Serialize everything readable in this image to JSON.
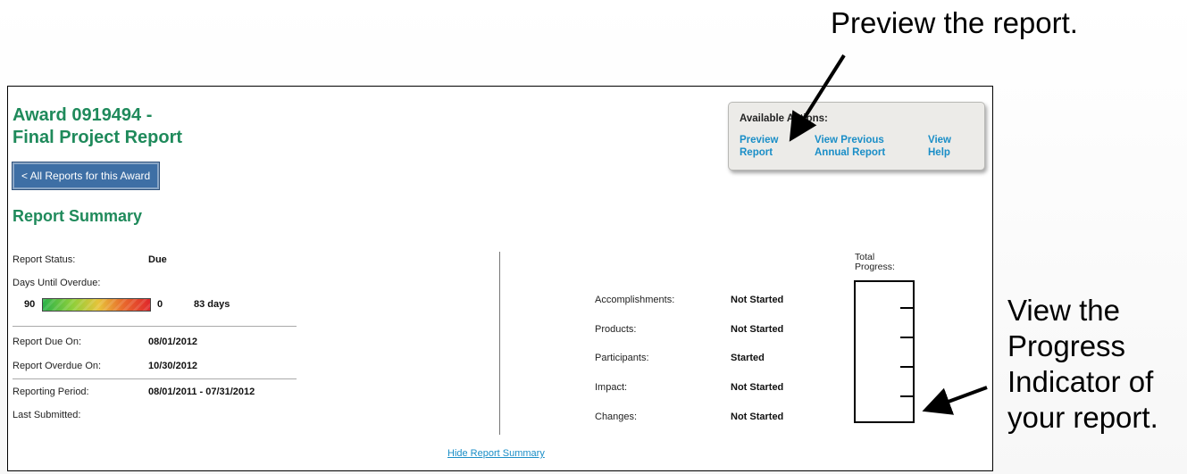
{
  "annotations": {
    "preview_callout": "Preview the report.",
    "progress_callout": [
      "View the",
      "Progress",
      "Indicator of",
      "your report."
    ]
  },
  "award": {
    "title_line1": "Award 0919494 -",
    "title_line2": "Final Project Report",
    "back_button": "< All Reports for this Award"
  },
  "actions": {
    "title": "Available Actions:",
    "preview": "Preview Report",
    "view_previous": "View Previous Annual Report",
    "view_help": "View Help"
  },
  "summary": {
    "heading": "Report Summary",
    "status_label": "Report Status:",
    "status_value": "Due",
    "days_label": "Days Until Overdue:",
    "meter_start": "90",
    "meter_end": "0",
    "days_value": "83 days",
    "days_remaining": 83,
    "days_total": 90,
    "due_label": "Report Due On:",
    "due_value": "08/01/2012",
    "overdue_label": "Report Overdue On:",
    "overdue_value": "10/30/2012",
    "period_label": "Reporting Period:",
    "period_value": "08/01/2011 - 07/31/2012",
    "submitted_label": "Last Submitted:",
    "submitted_value": ""
  },
  "sections": [
    {
      "label": "Accomplishments:",
      "status": "Not Started"
    },
    {
      "label": "Products:",
      "status": "Not Started"
    },
    {
      "label": "Participants:",
      "status": "Started"
    },
    {
      "label": "Impact:",
      "status": "Not Started"
    },
    {
      "label": "Changes:",
      "status": "Not Started"
    }
  ],
  "progress": {
    "title_line1": "Total",
    "title_line2": "Progress:",
    "fraction": 0
  },
  "hide_summary": "Hide Report Summary",
  "colors": {
    "heading_green": "#1f8a5b",
    "link_blue": "#1a8ec7",
    "button_blue": "#3e6fa5"
  }
}
